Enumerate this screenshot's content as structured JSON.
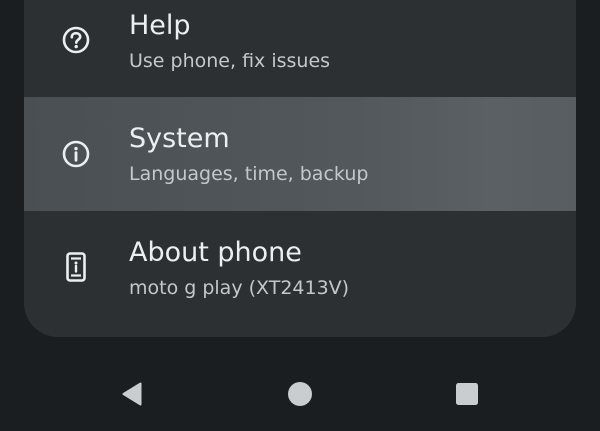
{
  "settings": {
    "items": [
      {
        "title": "Help",
        "subtitle": "Use phone, fix issues",
        "icon": "help-icon"
      },
      {
        "title": "System",
        "subtitle": "Languages, time, backup",
        "icon": "info-icon"
      },
      {
        "title": "About phone",
        "subtitle": "moto g play (XT2413V)",
        "icon": "phone-info-icon"
      }
    ]
  },
  "navigation": {
    "buttons": [
      "back-icon",
      "home-icon",
      "recents-icon"
    ]
  },
  "colors": {
    "background": "#1b1e21",
    "card": "#2c3033",
    "highlight": "#52585c",
    "text_primary": "#eceff1",
    "text_secondary": "#c3c8cc"
  }
}
